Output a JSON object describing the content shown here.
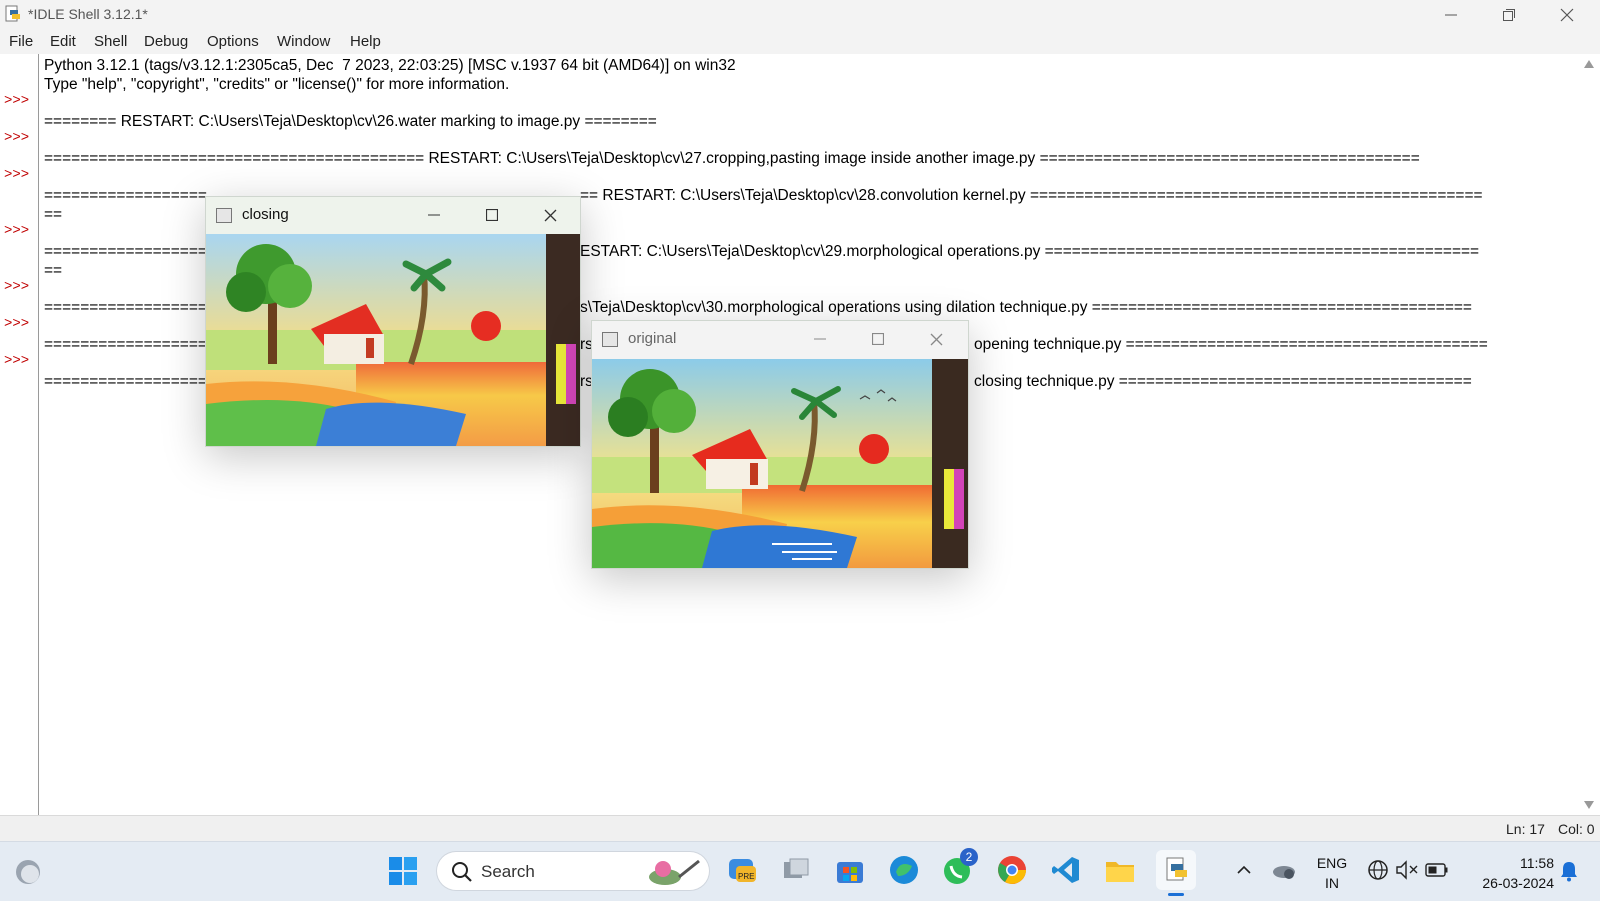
{
  "window": {
    "title": "*IDLE Shell 3.12.1*",
    "menu": [
      "File",
      "Edit",
      "Shell",
      "Debug",
      "Options",
      "Window",
      "Help"
    ]
  },
  "shell": {
    "prompt": ">>>",
    "lines": [
      "Python 3.12.1 (tags/v3.12.1:2305ca5, Dec  7 2023, 22:03:25) [MSC v.1937 64 bit (AMD64)] on win32",
      "Type \"help\", \"copyright\", \"credits\" or \"license()\" for more information.",
      "======== RESTART: C:\\Users\\Teja\\Desktop\\cv\\26.water marking to image.py ========",
      "========================================== RESTART: C:\\Users\\Teja\\Desktop\\cv\\27.cropping,pasting image inside another image.py ==========================================",
      "==================",
      "== RESTART: C:\\Users\\Teja\\Desktop\\cv\\28.convolution kernel.py ==================================================",
      "==",
      "==================",
      "ESTART: C:\\Users\\Teja\\Desktop\\cv\\29.morphological operations.py ================================================",
      "==",
      "==================",
      "s\\Teja\\Desktop\\cv\\30.morphological operations using dilation technique.py ==========================================",
      "==================",
      "rs",
      "opening technique.py ========================================",
      "==================",
      "rs",
      "closing technique.py ======================================="
    ]
  },
  "statusbar": {
    "line": "Ln: 17",
    "col": "Col: 0"
  },
  "popups": {
    "closing": {
      "title": "closing"
    },
    "original": {
      "title": "original"
    }
  },
  "taskbar": {
    "search_placeholder": "Search",
    "whatsapp_badge": "2",
    "lang_top": "ENG",
    "lang_bottom": "IN",
    "time": "11:58",
    "date": "26-03-2024"
  }
}
